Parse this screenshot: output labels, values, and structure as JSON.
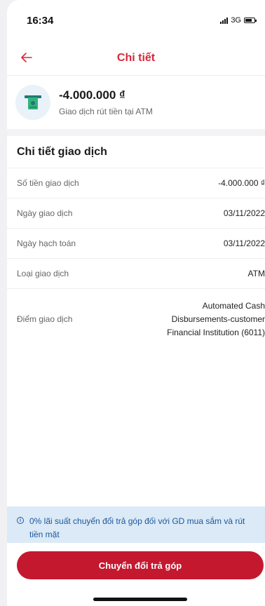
{
  "status_bar": {
    "time": "16:34",
    "network": "3G"
  },
  "header": {
    "title": "Chi tiết"
  },
  "summary": {
    "amount": "-4.000.000 ₫",
    "description": "Giao dịch rút tiền tại ATM"
  },
  "details": {
    "title": "Chi tiết giao dịch",
    "rows": [
      {
        "label": "Số tiền giao dịch",
        "value": "-4.000.000 ₫"
      },
      {
        "label": "Ngày giao dịch",
        "value": "03/11/2022"
      },
      {
        "label": "Ngày hạch toán",
        "value": "03/11/2022"
      },
      {
        "label": "Loại giao dịch",
        "value": "ATM"
      }
    ],
    "location": {
      "label": "Điểm giao dịch",
      "lines": [
        "Automated Cash",
        "Disbursements-customer",
        "Financial Institution (6011)"
      ]
    }
  },
  "notice": {
    "icon": "i",
    "text": "0% lãi suất chuyển đổi trả góp đối với GD mua sắm và rút tiền mặt"
  },
  "cta": {
    "label": "Chuyển đổi trả góp"
  },
  "colors": {
    "accent": "#d8283a",
    "button": "#c4182f",
    "notice_bg": "#dbeaf6",
    "notice_text": "#1c57a0"
  }
}
